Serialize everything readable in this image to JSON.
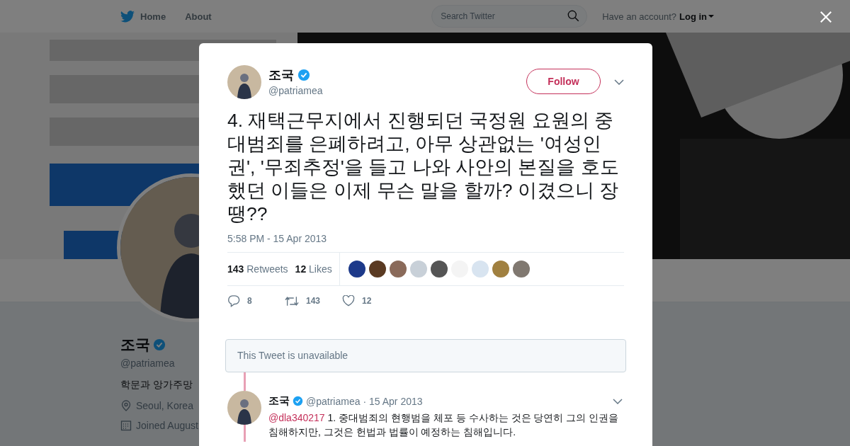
{
  "nav": {
    "links": [
      "Home",
      "About"
    ],
    "search": {
      "placeholder": "Search Twitter"
    },
    "account_prompt": "Have an account?",
    "login": "Log in"
  },
  "profile": {
    "name": "조국",
    "verified": true,
    "handle": "@patriamea",
    "bio": "학문과 앙가주망",
    "location": "Seoul, Korea",
    "joined": "Joined August"
  },
  "modal": {
    "tweet": {
      "name": "조국",
      "verified": true,
      "handle": "@patriamea",
      "follow_label": "Follow",
      "text": "4. 재택근무지에서 진행되던 국정원 요원의 중대범죄를 은폐하려고, 아무 상관없는 '여성인권', '무죄추정'을 들고 나와 사안의 본질을 호도했던 이들은 이제 무슨 말을 할까? 이겼으니 장땡??",
      "timestamp": "5:58 PM - 15 Apr 2013",
      "retweets": "143",
      "retweets_label": "Retweets",
      "likes": "12",
      "likes_label": "Likes",
      "likers": [
        {
          "color": "#1d3a8a"
        },
        {
          "color": "#5a3a22"
        },
        {
          "color": "#8a6a5a"
        },
        {
          "color": "#c8d0d8"
        },
        {
          "color": "#555555"
        },
        {
          "color": "#f4f4f4"
        },
        {
          "color": "#d8e4f0"
        },
        {
          "color": "#a08040"
        },
        {
          "color": "#807870"
        }
      ],
      "actions": [
        {
          "kind": "reply",
          "count": "8"
        },
        {
          "kind": "retweet",
          "count": "143"
        },
        {
          "kind": "like",
          "count": "12"
        }
      ]
    },
    "unavailable_notice": "This Tweet is unavailable",
    "replies": [
      {
        "name": "조국",
        "verified": true,
        "handle": "@patriamea",
        "date": "· 15 Apr 2013",
        "mention": "@dla340217",
        "text": "1. 중대범죄의 현행범을 체포 등 수사하는 것은 당연히 그의 인권을 침해하지만, 그것은 헌법과 법률이 예정하는 침해입니다."
      }
    ]
  }
}
